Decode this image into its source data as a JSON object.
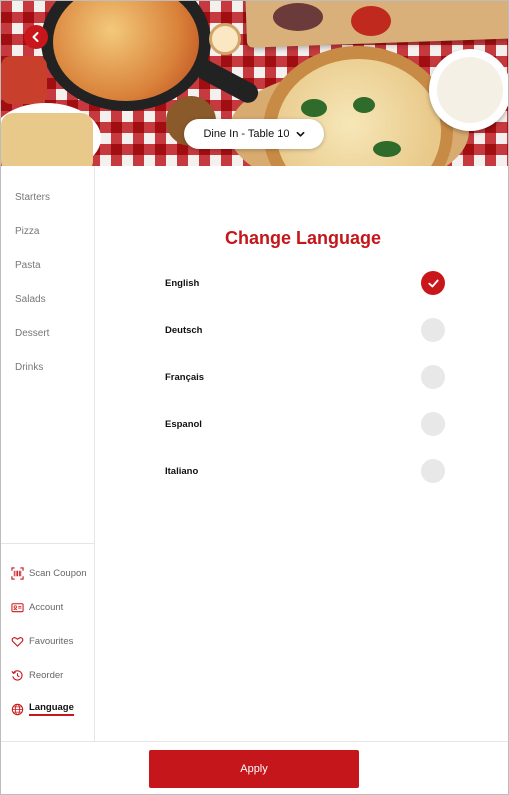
{
  "header": {
    "table_selector": "Dine In - Table 10",
    "back_icon": "chevron-left-icon",
    "dropdown_icon": "chevron-down-icon"
  },
  "sidebar": {
    "categories": [
      "Starters",
      "Pizza",
      "Pasta",
      "Salads",
      "Dessert",
      "Drinks"
    ],
    "bottom_items": [
      {
        "label": "Scan Coupon",
        "icon": "barcode-icon"
      },
      {
        "label": "Account",
        "icon": "id-card-icon"
      },
      {
        "label": "Favourites",
        "icon": "heart-icon"
      },
      {
        "label": "Reorder",
        "icon": "history-icon"
      },
      {
        "label": "Language",
        "icon": "globe-icon",
        "active": true
      }
    ]
  },
  "main": {
    "title": "Change Language",
    "languages": [
      {
        "name": "English",
        "selected": true
      },
      {
        "name": "Deutsch",
        "selected": false
      },
      {
        "name": "Français",
        "selected": false
      },
      {
        "name": "Espanol",
        "selected": false
      },
      {
        "name": "Italiano",
        "selected": false
      }
    ]
  },
  "footer": {
    "apply_label": "Apply"
  },
  "colors": {
    "accent": "#c4161b",
    "radio_off": "#e8e8e8"
  }
}
